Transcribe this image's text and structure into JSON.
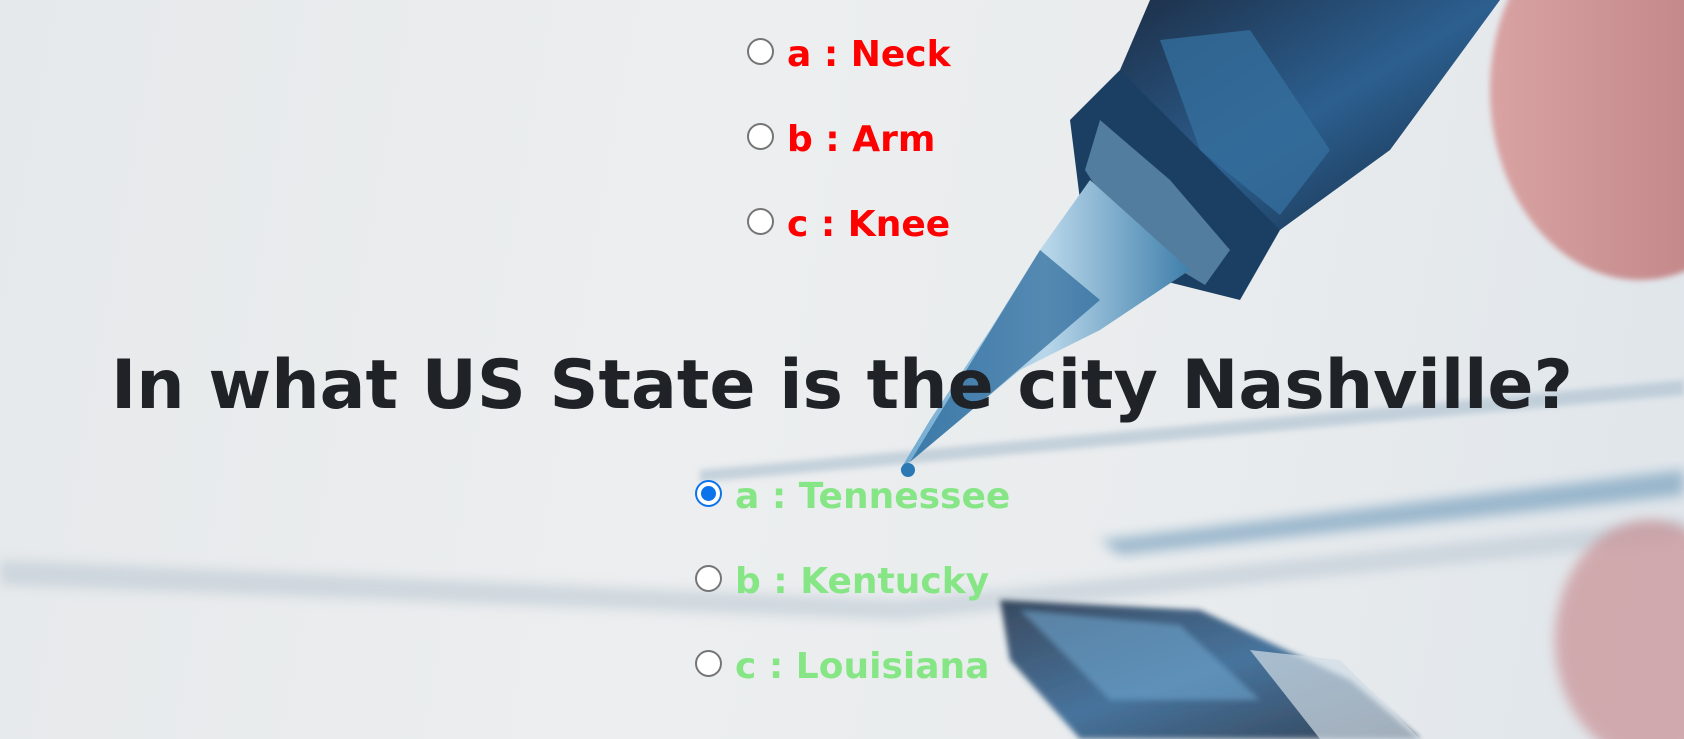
{
  "colors": {
    "wrong_answer": "#ff0000",
    "answer": "#86e686",
    "question": "#1f2328",
    "radio_checked": "#0b74ea"
  },
  "background": {
    "image": "fountain-pen-photo"
  },
  "previous_question": {
    "options": [
      {
        "label": "a : Neck",
        "checked": false
      },
      {
        "label": "b : Arm",
        "checked": false
      },
      {
        "label": "c : Knee",
        "checked": false
      }
    ]
  },
  "current_question": {
    "text": "In what US State is the city Nashville?",
    "options": [
      {
        "label": "a : Tennessee",
        "checked": true
      },
      {
        "label": "b : Kentucky",
        "checked": false
      },
      {
        "label": "c : Louisiana",
        "checked": false
      }
    ]
  }
}
